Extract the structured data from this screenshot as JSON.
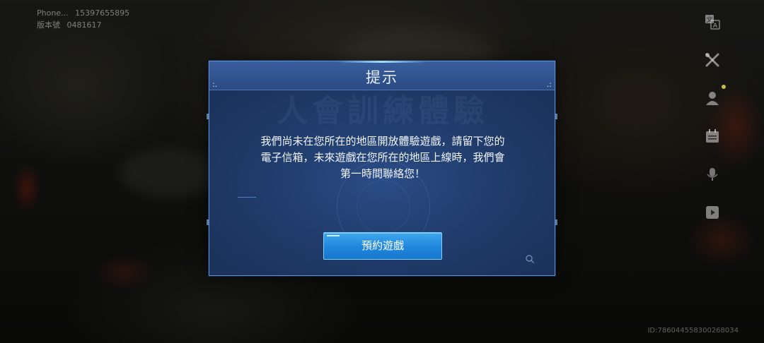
{
  "background": {
    "account": {
      "phone_label": "Phone...",
      "phone_value": "15397655895",
      "version_label": "版本號",
      "version_value": "0481617"
    },
    "player_id": "ID:786044558300268034"
  },
  "sidebar": {
    "icons": [
      "translate-icon",
      "tools-icon",
      "profile-icon",
      "calendar-icon",
      "microphone-icon",
      "play-video-icon"
    ]
  },
  "dialog": {
    "title": "提示",
    "watermark": "人會訓練體驗",
    "message_line1": "我們尚未在您所在的地區開放體驗遊戲，請留下您的",
    "message_line2": "電子信箱，未來遊戲在您所在的地區上線時，我們會",
    "message_line3": "第一時間聯絡您！",
    "button_label": "預約遊戲"
  },
  "colors": {
    "dialog_bg": "#213d6d",
    "dialog_border": "#5f8fcf",
    "button_bg": "#1f86dc",
    "title_text": "#e8f0ff"
  }
}
